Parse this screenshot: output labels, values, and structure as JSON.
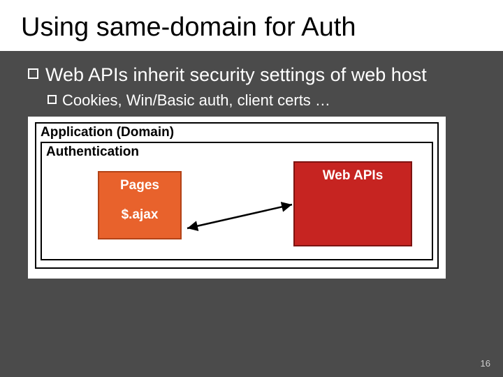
{
  "title": "Using same-domain for Auth",
  "bullets": {
    "main": "Web APIs inherit security settings of web host",
    "sub": "Cookies, Win/Basic auth, client certs …"
  },
  "diagram": {
    "app_label": "Application (Domain)",
    "auth_label": "Authentication",
    "pages_label": "Pages",
    "ajax_label": "$.ajax",
    "webapi_label": "Web APIs"
  },
  "page_number": "16"
}
